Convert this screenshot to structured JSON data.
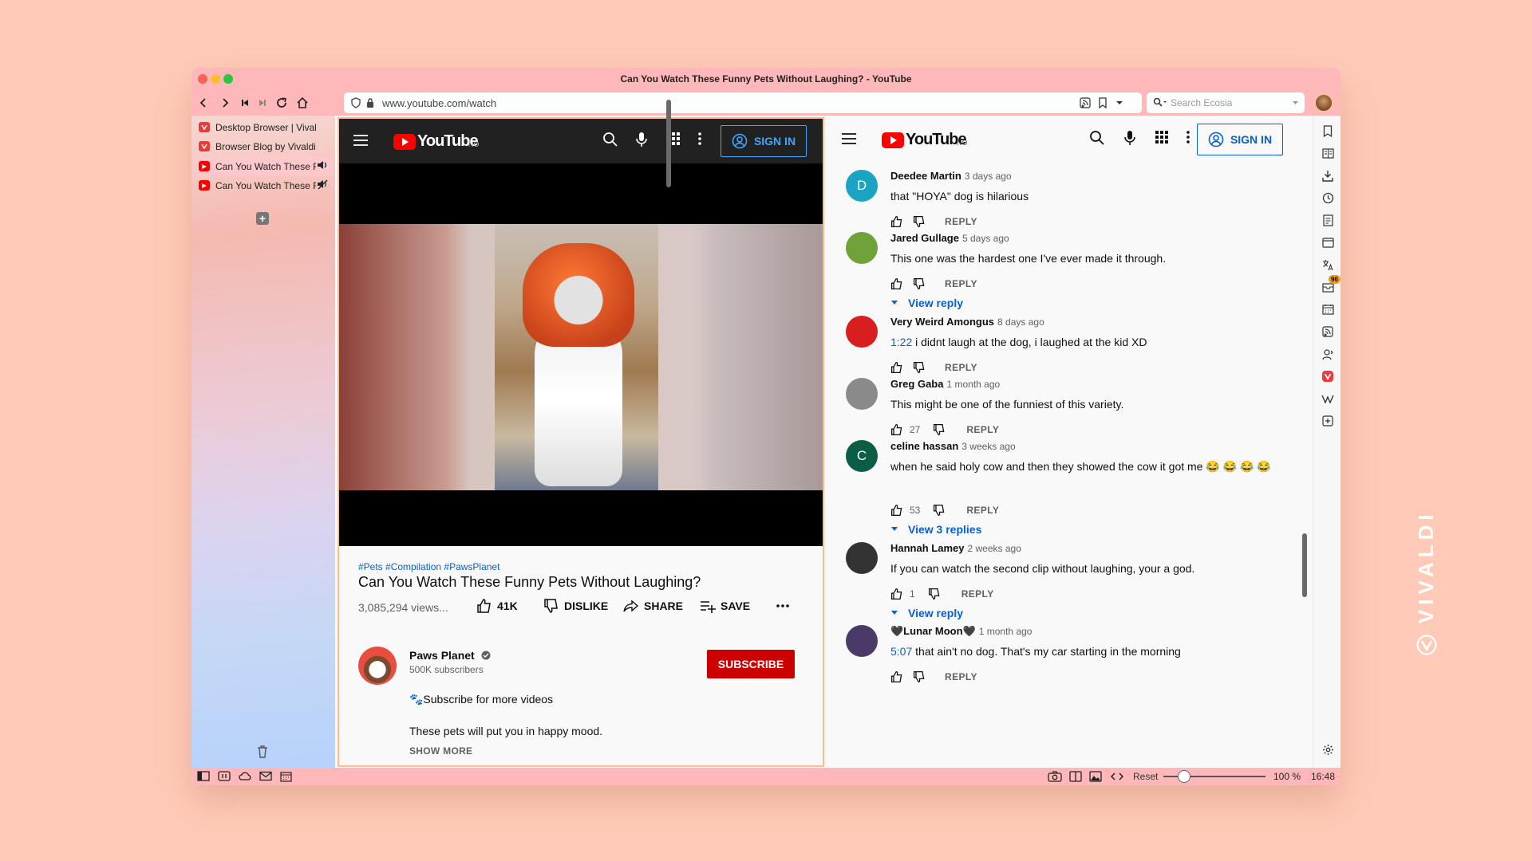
{
  "window": {
    "title": "Can You Watch These Funny Pets Without Laughing? - YouTube"
  },
  "address": {
    "url": "www.youtube.com/watch",
    "search_placeholder": "Search Ecosia"
  },
  "tabs": [
    {
      "label": "Desktop Browser | Vivaldi Browser",
      "icon": "vivaldi-icon",
      "color": "#ef3939"
    },
    {
      "label": "Browser Blog by Vivaldi - News",
      "icon": "vivaldi-icon",
      "color": "#ef3939"
    },
    {
      "label": "Can You Watch These Funny Pets",
      "icon": "youtube-icon",
      "color": "#ff0000",
      "status": "speaker-icon"
    },
    {
      "label": "Can You Watch These Funny Pets",
      "icon": "youtube-icon",
      "color": "#ff0000",
      "status": "muted-speaker-icon"
    }
  ],
  "youtube": {
    "logo": "YouTube",
    "region": "NO",
    "sign_in": "SIGN IN"
  },
  "video": {
    "tags": "#Pets #Compilation #PawsPlanet",
    "title": "Can You Watch These Funny Pets Without Laughing?",
    "views": "3,085,294 views...",
    "likes": "41K",
    "dislike": "DISLIKE",
    "share": "SHARE",
    "save": "SAVE"
  },
  "channel": {
    "name": "Paws Planet",
    "subscribers": "500K subscribers",
    "subscribe": "SUBSCRIBE",
    "desc1": "🐾Subscribe for more videos",
    "desc2": "These pets will put you in happy mood.",
    "show_more": "SHOW MORE"
  },
  "comments": [
    {
      "author": "Deedee Martin",
      "time": "3 days ago",
      "text": "that \"HOYA\" dog is hilarious",
      "avatar_letter": "D",
      "avatar_color": "#1aa3c2",
      "likes": "",
      "reply": "REPLY"
    },
    {
      "author": "Jared Gullage",
      "time": "5 days ago",
      "text": "This one was the hardest one I've ever made it through.",
      "avatar_color": "#6fa33a",
      "likes": "",
      "reply": "REPLY",
      "view": "View reply"
    },
    {
      "author": "Very Weird Amongus",
      "time": "8 days ago",
      "timestamp": "1:22",
      "text": " i didnt laugh at the dog, i laughed at the kid XD",
      "avatar_color": "#d81e1e",
      "likes": "",
      "reply": "REPLY"
    },
    {
      "author": "Greg Gaba",
      "time": "1 month ago",
      "text": "This might be one of the funniest of this variety.",
      "avatar_color": "#8a8a8a",
      "likes": "27",
      "reply": "REPLY"
    },
    {
      "author": "celine hassan",
      "time": "3 weeks ago",
      "text": "when he said holy cow and then they showed the cow it got me 😂 😂 😂 😂",
      "avatar_letter": "C",
      "avatar_color": "#0b5e45",
      "likes": "53",
      "reply": "REPLY",
      "view": "View 3 replies"
    },
    {
      "author": "Hannah Lamey",
      "time": "2 weeks ago",
      "text": "If you can watch the second clip without laughing, your a god.",
      "avatar_color": "#333333",
      "likes": "1",
      "reply": "REPLY",
      "view": "View reply"
    },
    {
      "author": "🖤Lunar Moon🖤",
      "time": "1 month ago",
      "timestamp": "5:07",
      "text": " that ain't no dog. That's my car starting in the morning",
      "avatar_color": "#4a3a6a",
      "likes": "",
      "reply": "REPLY"
    }
  ],
  "panel": {
    "mail_badge": "96"
  },
  "status": {
    "reset": "Reset",
    "zoom": "100 %",
    "clock": "16:48"
  },
  "brand": {
    "word": "VIVALDI"
  },
  "colors": {
    "chrome": "#ffb8b9",
    "accent": "#ef3939",
    "youtube_red": "#ff0000",
    "link": "#065fd4"
  }
}
